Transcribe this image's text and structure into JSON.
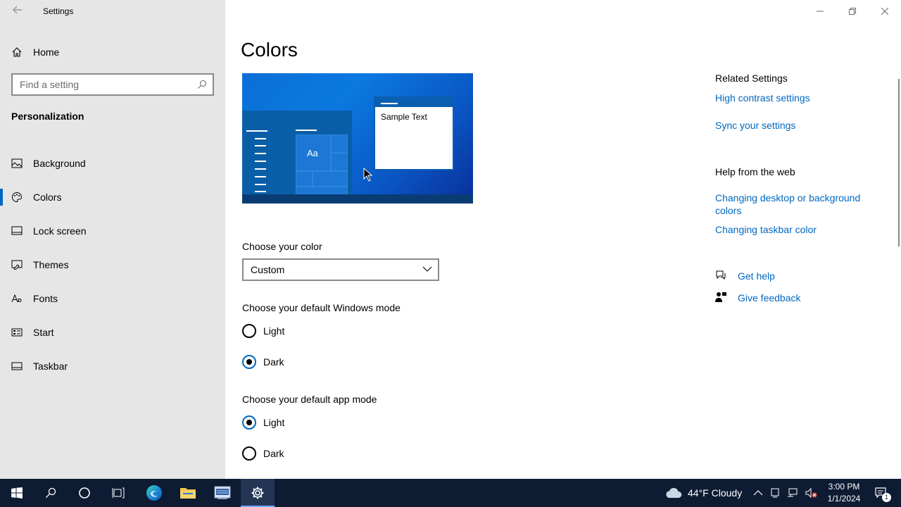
{
  "window": {
    "title": "Settings"
  },
  "sidebar": {
    "home_label": "Home",
    "search_placeholder": "Find a setting",
    "section_heading": "Personalization",
    "items": [
      {
        "label": "Background",
        "icon": "picture-icon"
      },
      {
        "label": "Colors",
        "icon": "palette-icon",
        "active": true
      },
      {
        "label": "Lock screen",
        "icon": "lock-screen-icon"
      },
      {
        "label": "Themes",
        "icon": "brush-icon"
      },
      {
        "label": "Fonts",
        "icon": "font-icon"
      },
      {
        "label": "Start",
        "icon": "start-icon"
      },
      {
        "label": "Taskbar",
        "icon": "taskbar-icon"
      }
    ]
  },
  "main": {
    "title": "Colors",
    "preview": {
      "sample_text": "Sample Text",
      "tile_text": "Aa"
    },
    "choose_color": {
      "label": "Choose your color",
      "selected": "Custom"
    },
    "windows_mode": {
      "label": "Choose your default Windows mode",
      "options": [
        "Light",
        "Dark"
      ],
      "selected": "Dark"
    },
    "app_mode": {
      "label": "Choose your default app mode",
      "options": [
        "Light",
        "Dark"
      ],
      "selected": "Light"
    }
  },
  "related": {
    "heading": "Related Settings",
    "links": [
      "High contrast settings",
      "Sync your settings"
    ],
    "web_heading": "Help from the web",
    "web_links": [
      "Changing desktop or background colors",
      "Changing taskbar color"
    ],
    "get_help": "Get help",
    "give_feedback": "Give feedback"
  },
  "taskbar": {
    "weather": "44°F  Cloudy",
    "time": "3:00 PM",
    "date": "1/1/2024",
    "notification_count": "1"
  },
  "colors": {
    "accent": "#0067c0",
    "sidebar_bg": "#e6e6e6",
    "taskbar_bg": "#0d1b33"
  }
}
